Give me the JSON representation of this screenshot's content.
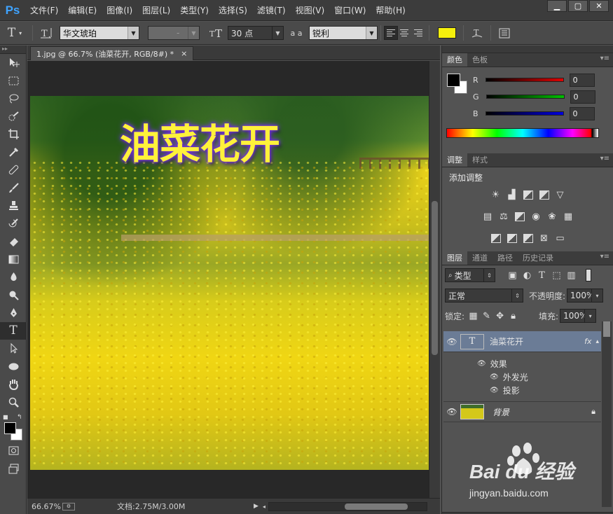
{
  "app": {
    "logo": "Ps"
  },
  "menu": [
    "文件(F)",
    "编辑(E)",
    "图像(I)",
    "图层(L)",
    "类型(Y)",
    "选择(S)",
    "滤镜(T)",
    "视图(V)",
    "窗口(W)",
    "帮助(H)"
  ],
  "window_buttons": {
    "minimize": "▁",
    "maximize": "▢",
    "close": "✕"
  },
  "options": {
    "tool_glyph": "T",
    "font_family": "华文琥珀",
    "font_style": "-",
    "font_size": "30 点",
    "aa_label": "a a",
    "anti_alias": "锐利",
    "text_color": "#f5f00c"
  },
  "document": {
    "tab_title": "1.jpg @ 66.7% (油菜花开, RGB/8#) *",
    "tab_close": "×",
    "canvas_text": "油菜花开"
  },
  "status": {
    "zoom": "66.67%",
    "doc_size": "文档:2.75M/3.00M"
  },
  "color_panel": {
    "tabs": [
      "颜色",
      "色板"
    ],
    "channels": [
      {
        "label": "R",
        "value": "0",
        "color": "#e00000"
      },
      {
        "label": "G",
        "value": "0",
        "color": "#00c000"
      },
      {
        "label": "B",
        "value": "0",
        "color": "#0000e0"
      }
    ]
  },
  "adjust_panel": {
    "tabs": [
      "调整",
      "样式"
    ],
    "title": "添加调整"
  },
  "layers_panel": {
    "tabs": [
      "图层",
      "通道",
      "路径",
      "历史记录"
    ],
    "filter_label": "类型",
    "blend_mode": "正常",
    "opacity_label": "不透明度:",
    "opacity_value": "100%",
    "lock_label": "锁定:",
    "fill_label": "填充:",
    "fill_value": "100%",
    "layers": [
      {
        "name": "油菜花开",
        "type": "text",
        "fx": "fx",
        "selected": true
      },
      {
        "name": "背景",
        "type": "image",
        "locked": true
      }
    ],
    "effects_label": "效果",
    "effects": [
      "外发光",
      "投影"
    ]
  },
  "watermark": {
    "brand": "Bai du 经验",
    "url": "jingyan.baidu.com"
  }
}
